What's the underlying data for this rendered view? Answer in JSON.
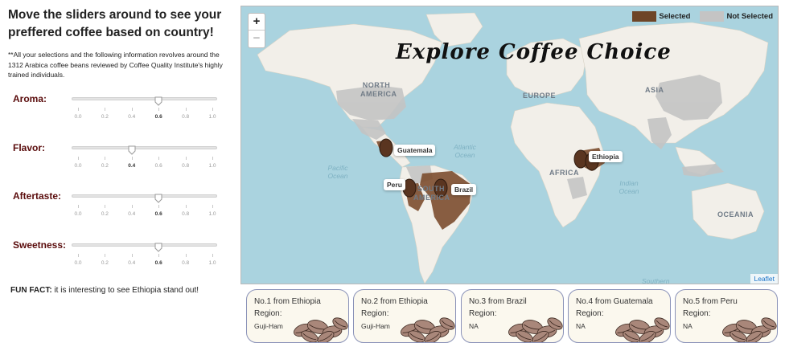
{
  "sidebar": {
    "heading": "Move the sliders around to see your preffered coffee based on country!",
    "note": "**All your selections and the following information revolves around the 1312 Arabica coffee beans reviewed by Coffee Quality Institute's highly trained individuals.",
    "tick_labels": [
      "0.0",
      "0.2",
      "0.4",
      "0.6",
      "0.8",
      "1.0"
    ],
    "sliders": [
      {
        "label": "Aroma:",
        "value": 0.6
      },
      {
        "label": "Flavor:",
        "value": 0.4
      },
      {
        "label": "Aftertaste:",
        "value": 0.6
      },
      {
        "label": "Sweetness:",
        "value": 0.6
      }
    ],
    "fun_fact_label": "FUN FACT:",
    "fun_fact_text": "it is interesting to see Ethiopia stand out!"
  },
  "map": {
    "title": "Explore Coffee Choice",
    "zoom_in": "+",
    "zoom_out": "−",
    "legend": {
      "selected_label": "Selected",
      "not_selected_label": "Not Selected",
      "selected_color": "#6e4527",
      "not_selected_color": "#c4c4c4"
    },
    "continent_labels": {
      "north_america": "NORTH AMERICA",
      "south_america": "SOUTH AMERICA",
      "europe": "EUROPE",
      "africa": "AFRICA",
      "asia": "ASIA",
      "oceania": "OCEANIA"
    },
    "ocean_labels": {
      "atlantic": "Atlantic Ocean",
      "pacific": "Pacific Ocean",
      "indian": "Indian Ocean",
      "southern": "Southern"
    },
    "markers": [
      {
        "label": "Guatemala"
      },
      {
        "label": "Ethiopia"
      },
      {
        "label": "Peru"
      },
      {
        "label": "Brazil"
      }
    ],
    "attribution": "Leaflet"
  },
  "cards": [
    {
      "title": "No.1 from Ethiopia",
      "region_label": "Region:",
      "region": "Guji-Ham"
    },
    {
      "title": "No.2 from Ethiopia",
      "region_label": "Region:",
      "region": "Guji-Ham"
    },
    {
      "title": "No.3 from Brazil",
      "region_label": "Region:",
      "region": "NA"
    },
    {
      "title": "No.4 from Guatemala",
      "region_label": "Region:",
      "region": "NA"
    },
    {
      "title": "No.5 from Peru",
      "region_label": "Region:",
      "region": "NA"
    }
  ]
}
